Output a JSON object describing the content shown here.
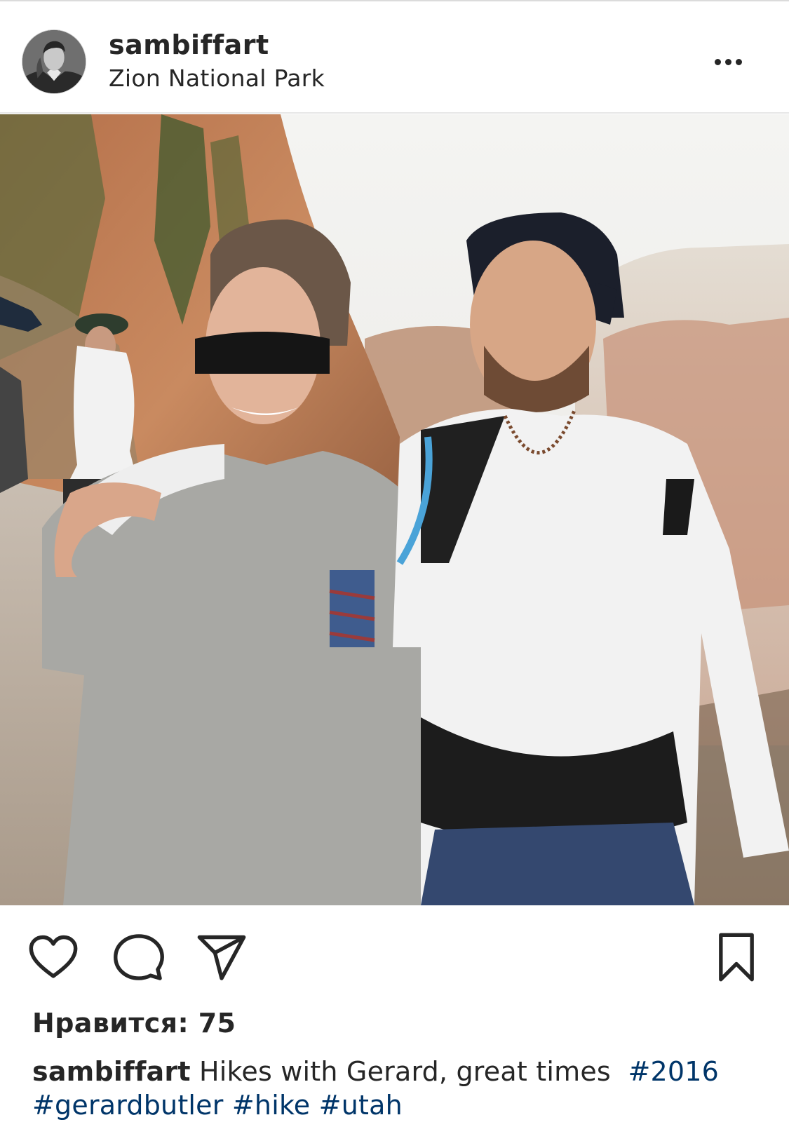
{
  "post": {
    "username": "sambiffart",
    "location": "Zion National Park",
    "likes_text": "Нравится: 75",
    "caption": {
      "username": "sambiffart",
      "text": "Hikes with Gerard, great times",
      "hashtags": [
        "#2016",
        "#gerardbutler",
        "#hike",
        "#utah"
      ]
    }
  },
  "icons": {
    "more": "more-options-icon",
    "like": "heart-icon",
    "comment": "comment-bubble-icon",
    "share": "paper-plane-icon",
    "save": "bookmark-icon"
  },
  "colors": {
    "text": "#262626",
    "hashtag": "#003569",
    "divider": "#e6e6e6"
  }
}
